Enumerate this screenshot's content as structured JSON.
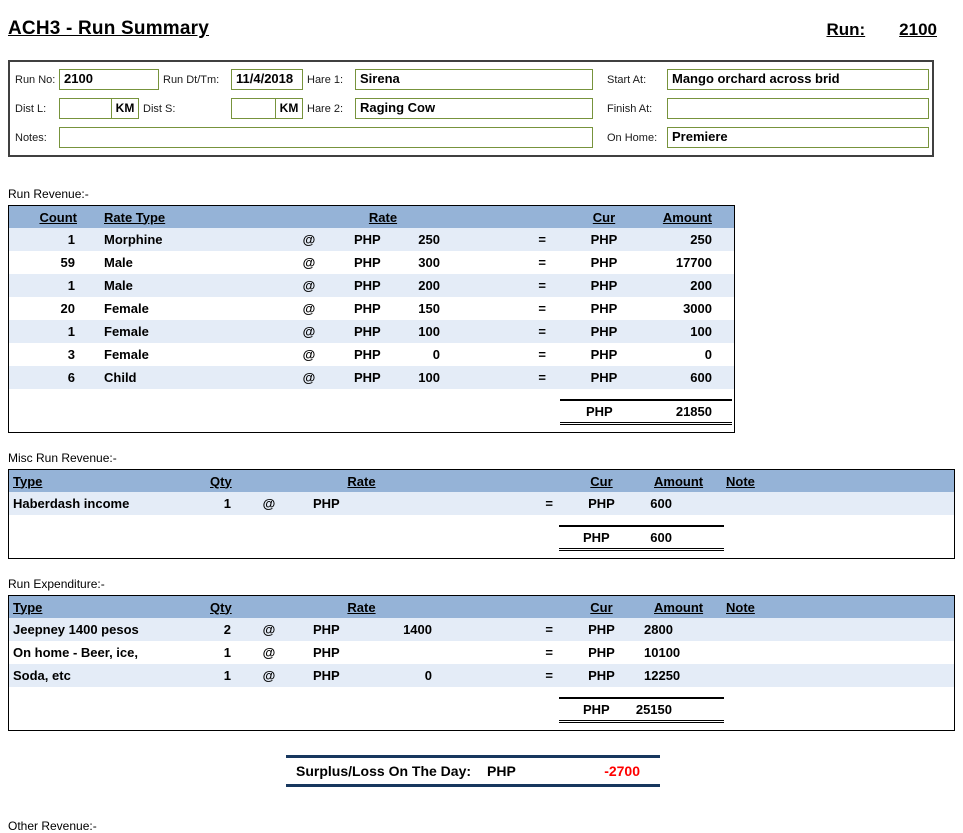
{
  "header": {
    "title": "ACH3 - Run Summary",
    "run_label": "Run:",
    "run_value": "2100"
  },
  "form": {
    "run_no_label": "Run No:",
    "run_no": "2100",
    "run_dt_label": "Run Dt/Tm:",
    "run_dt": "11/4/2018",
    "hare1_label": "Hare 1:",
    "hare1": "Sirena",
    "start_at_label": "Start At:",
    "start_at": "Mango orchard across brid",
    "dist_l_label": "Dist L:",
    "dist_l": "",
    "dist_l_unit": "KM",
    "dist_s_label": "Dist S:",
    "dist_s": "",
    "dist_s_unit": "KM",
    "hare2_label": "Hare 2:",
    "hare2": "Raging Cow",
    "finish_at_label": "Finish At:",
    "finish_at": "",
    "notes_label": "Notes:",
    "notes": "",
    "on_home_label": "On Home:",
    "on_home": "Premiere"
  },
  "run_revenue": {
    "section_label": "Run Revenue:-",
    "headers": {
      "count": "Count",
      "rate_type": "Rate Type",
      "rate": "Rate",
      "cur": "Cur",
      "amount": "Amount"
    },
    "rows": [
      {
        "count": "1",
        "rate_type": "Morphine",
        "at": "@",
        "rate_cur": "PHP",
        "rate": "250",
        "eq": "=",
        "cur": "PHP",
        "amount": "250"
      },
      {
        "count": "59",
        "rate_type": "Male",
        "at": "@",
        "rate_cur": "PHP",
        "rate": "300",
        "eq": "=",
        "cur": "PHP",
        "amount": "17700"
      },
      {
        "count": "1",
        "rate_type": "Male",
        "at": "@",
        "rate_cur": "PHP",
        "rate": "200",
        "eq": "=",
        "cur": "PHP",
        "amount": "200"
      },
      {
        "count": "20",
        "rate_type": "Female",
        "at": "@",
        "rate_cur": "PHP",
        "rate": "150",
        "eq": "=",
        "cur": "PHP",
        "amount": "3000"
      },
      {
        "count": "1",
        "rate_type": "Female",
        "at": "@",
        "rate_cur": "PHP",
        "rate": "100",
        "eq": "=",
        "cur": "PHP",
        "amount": "100"
      },
      {
        "count": "3",
        "rate_type": "Female",
        "at": "@",
        "rate_cur": "PHP",
        "rate": "0",
        "eq": "=",
        "cur": "PHP",
        "amount": "0"
      },
      {
        "count": "6",
        "rate_type": "Child",
        "at": "@",
        "rate_cur": "PHP",
        "rate": "100",
        "eq": "=",
        "cur": "PHP",
        "amount": "600"
      }
    ],
    "total": {
      "cur": "PHP",
      "amount": "21850"
    }
  },
  "misc_revenue": {
    "section_label": "Misc Run Revenue:-",
    "headers": {
      "type": "Type",
      "qty": "Qty",
      "rate": "Rate",
      "cur": "Cur",
      "amount": "Amount",
      "note": "Note"
    },
    "rows": [
      {
        "type": "Haberdash income",
        "qty": "1",
        "at": "@",
        "rate_cur": "PHP",
        "rate": "",
        "eq": "=",
        "cur": "PHP",
        "amount": "600",
        "note": ""
      }
    ],
    "total": {
      "cur": "PHP",
      "amount": "600"
    }
  },
  "expenditure": {
    "section_label": "Run Expenditure:-",
    "headers": {
      "type": "Type",
      "qty": "Qty",
      "rate": "Rate",
      "cur": "Cur",
      "amount": "Amount",
      "note": "Note"
    },
    "rows": [
      {
        "type": "Jeepney 1400 pesos",
        "qty": "2",
        "at": "@",
        "rate_cur": "PHP",
        "rate": "1400",
        "eq": "=",
        "cur": "PHP",
        "amount": "2800",
        "note": ""
      },
      {
        "type": "On home - Beer, ice,",
        "qty": "1",
        "at": "@",
        "rate_cur": "PHP",
        "rate": "",
        "eq": "=",
        "cur": "PHP",
        "amount": "10100",
        "note": ""
      },
      {
        "type": "Soda, etc",
        "qty": "1",
        "at": "@",
        "rate_cur": "PHP",
        "rate": "0",
        "eq": "=",
        "cur": "PHP",
        "amount": "12250",
        "note": ""
      }
    ],
    "total": {
      "cur": "PHP",
      "amount": "25150"
    }
  },
  "surplus": {
    "label": "Surplus/Loss On The Day:",
    "cur": "PHP",
    "amount": "-2700"
  },
  "other_revenue": {
    "section_label": "Other Revenue:-"
  },
  "colors": {
    "table_header": "#95B3D7",
    "band": "#E4ECF7",
    "negative": "#FF0000",
    "surplus_border": "#17375E",
    "field_border": "#77933C"
  }
}
